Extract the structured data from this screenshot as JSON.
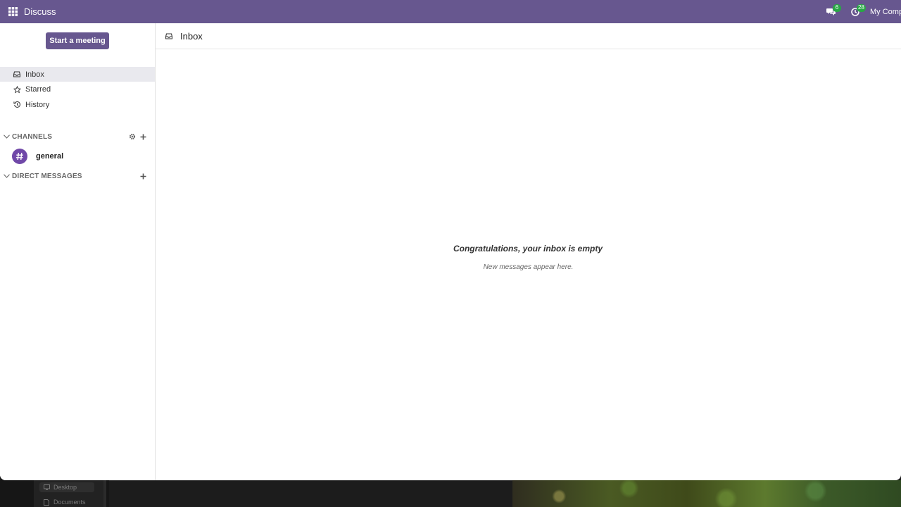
{
  "navbar": {
    "app_name": "Discuss",
    "messages_badge": "6",
    "activities_badge": "28",
    "company": "My Company",
    "bg_color": "#67578f"
  },
  "sidebar": {
    "start_meeting_label": "Start a meeting",
    "items": [
      {
        "label": "Inbox",
        "icon": "inbox-icon",
        "active": true
      },
      {
        "label": "Starred",
        "icon": "star-icon",
        "active": false
      },
      {
        "label": "History",
        "icon": "history-icon",
        "active": false
      }
    ],
    "channels_label": "CHANNELS",
    "channels": [
      {
        "name": "general",
        "icon": "hashtag-icon"
      }
    ],
    "direct_messages_label": "DIRECT MESSAGES"
  },
  "main": {
    "title": "Inbox",
    "empty_title": "Congratulations, your inbox is empty",
    "empty_subtitle": "New messages appear here."
  },
  "desktop": {
    "finder_items": [
      "Desktop",
      "Documents"
    ]
  },
  "colors": {
    "accent": "#67578f",
    "channel_avatar": "#7048a8",
    "badge": "#28a745"
  }
}
